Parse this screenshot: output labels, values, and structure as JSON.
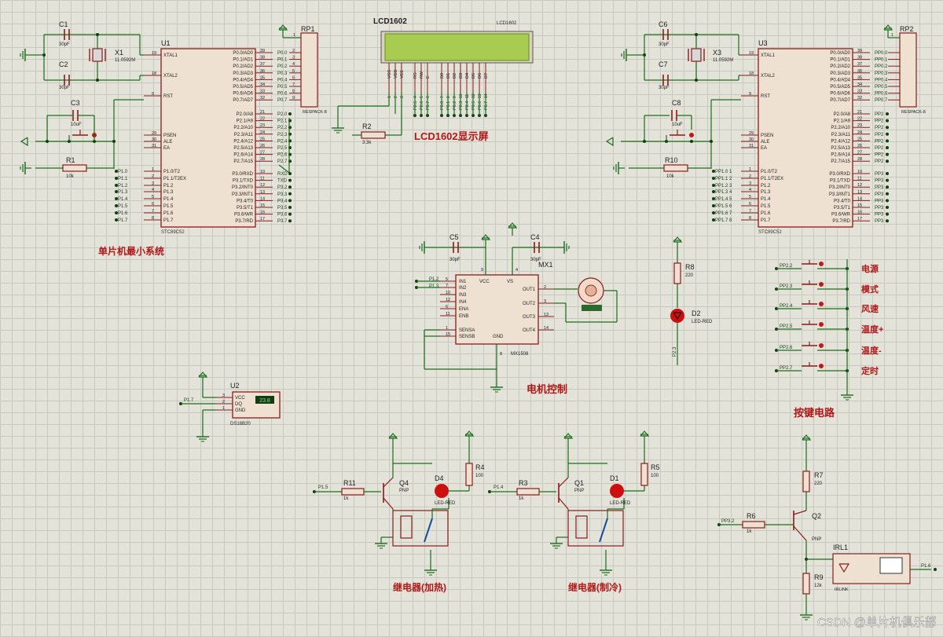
{
  "section_labels": {
    "mcu_min": "单片机最小系统",
    "lcd_screen": "LCD1602显示屏",
    "motor_ctrl": "电机控制",
    "keys": "按键电路",
    "relay_heat": "继电器(加热)",
    "relay_cool": "继电器(制冷)"
  },
  "key_labels": [
    "电源",
    "模式",
    "风速",
    "温度+",
    "温度-",
    "定时"
  ],
  "watermark": "CSDN @单片机俱乐部",
  "colors": {
    "background": "#e4e3da",
    "grid": "#c9c8be",
    "wire": "#1a6e1a",
    "component": "#8b1a1a",
    "chip_fill": "#efe1d2",
    "label_red": "#b01818",
    "lcd_screen": "#a8cc52",
    "pin_dot": "#123c12"
  },
  "u1": {
    "ref": "U1",
    "part": "STC89C52",
    "left_pins": [
      {
        "num": "19",
        "name": "XTAL1"
      },
      {
        "num": "18",
        "name": "XTAL2"
      },
      {
        "num": "9",
        "name": "RST"
      },
      {
        "num": "29",
        "name": "PSEN"
      },
      {
        "num": "30",
        "name": "ALE"
      },
      {
        "num": "31",
        "name": "EA"
      },
      {
        "num": "1",
        "name": "P1.0/T2"
      },
      {
        "num": "2",
        "name": "P1.1/T2EX"
      },
      {
        "num": "3",
        "name": "P1.2"
      },
      {
        "num": "4",
        "name": "P1.3"
      },
      {
        "num": "5",
        "name": "P1.4"
      },
      {
        "num": "6",
        "name": "P1.5"
      },
      {
        "num": "7",
        "name": "P1.6"
      },
      {
        "num": "8",
        "name": "P1.7"
      }
    ],
    "right_pins": [
      {
        "num": "39",
        "name": "P0.0/AD0"
      },
      {
        "num": "38",
        "name": "P0.1/AD1"
      },
      {
        "num": "37",
        "name": "P0.2/AD2"
      },
      {
        "num": "36",
        "name": "P0.3/AD3"
      },
      {
        "num": "35",
        "name": "P0.4/AD4"
      },
      {
        "num": "34",
        "name": "P0.5/AD5"
      },
      {
        "num": "33",
        "name": "P0.6/AD6"
      },
      {
        "num": "32",
        "name": "P0.7/AD7"
      },
      {
        "num": "21",
        "name": "P2.0/A8"
      },
      {
        "num": "22",
        "name": "P2.1/A9"
      },
      {
        "num": "23",
        "name": "P2.2/A10"
      },
      {
        "num": "24",
        "name": "P2.3/A11"
      },
      {
        "num": "25",
        "name": "P2.4/A12"
      },
      {
        "num": "26",
        "name": "P2.5/A13"
      },
      {
        "num": "27",
        "name": "P2.6/A14"
      },
      {
        "num": "28",
        "name": "P2.7/A15"
      },
      {
        "num": "10",
        "name": "P3.0/RXD"
      },
      {
        "num": "11",
        "name": "P3.1/TXD"
      },
      {
        "num": "12",
        "name": "P3.2/INT0"
      },
      {
        "num": "13",
        "name": "P3.3/INT1"
      },
      {
        "num": "14",
        "name": "P3.4/T0"
      },
      {
        "num": "15",
        "name": "P3.5/T1"
      },
      {
        "num": "16",
        "name": "P3.6/WR"
      },
      {
        "num": "17",
        "name": "P3.7/RD"
      }
    ],
    "left_net_labels": [
      "P1.0",
      "P1.1",
      "P1.2",
      "P1.3",
      "P1.4",
      "P1.5",
      "P1.6",
      "P1.7"
    ],
    "right_net_labels": [
      "P0.0",
      "P0.1",
      "P0.2",
      "P0.3",
      "P0.4",
      "P0.5",
      "P0.6",
      "P0.7",
      "P2.0",
      "P2.1",
      "P2.2",
      "P2.3",
      "P2.4",
      "P2.5",
      "P2.6",
      "P2.7",
      "RXD",
      "TXD",
      "P3.2",
      "P3.3",
      "P3.4",
      "P3.5",
      "P3.6",
      "P3.7"
    ]
  },
  "u3": {
    "ref": "U3",
    "part": "STC89C52",
    "left_net_labels": [
      "PP1.0 1",
      "PP1.1 2",
      "PP1.2 3",
      "PP1.3 4",
      "PP1.4 5",
      "PP1.5 6",
      "PP1.6 7",
      "PP1.7 8"
    ],
    "right_net_labels": [
      "PP0.0",
      "PP0.1",
      "PP0.2",
      "PP0.3",
      "PP0.4",
      "PP0.5",
      "PP0.6",
      "PP0.7",
      "PP2",
      "PP2",
      "PP2",
      "PP2",
      "PP2",
      "PP2",
      "PP2",
      "PP2",
      "PP3",
      "PP3",
      "PP3",
      "PP3",
      "PP3",
      "PP3",
      "PP3",
      "PP3"
    ]
  },
  "rp1": {
    "ref": "RP1",
    "part": "RESPACK-8",
    "pin1": "1"
  },
  "rp2": {
    "ref": "RP2",
    "part": "RESPACK-8",
    "pin1": "1"
  },
  "lcd": {
    "title": "LCD1602",
    "part": "LCD1602",
    "pins": [
      "VSS",
      "VDD",
      "VEE",
      "RS",
      "RW",
      "E",
      "D0",
      "D1",
      "D2",
      "D3",
      "D4",
      "D5",
      "D6",
      "D7"
    ],
    "pin_nums": [
      "1",
      "2",
      "3",
      "4",
      "5",
      "6",
      "7",
      "8",
      "9",
      "10",
      "11",
      "12",
      "13",
      "14"
    ],
    "nets": [
      "P2.5",
      "P2.6",
      "P2.7",
      "P0.0",
      "P0.1",
      "P0.2",
      "P0.3",
      "P0.4",
      "P0.5",
      "P0.6",
      "P0.7"
    ]
  },
  "left_mcu": {
    "c1": {
      "ref": "C1",
      "value": "30pF"
    },
    "c2": {
      "ref": "C2",
      "value": "30pF"
    },
    "x1": {
      "ref": "X1",
      "value": "11.0592M"
    },
    "c3": {
      "ref": "C3",
      "value": "10uF"
    },
    "r1": {
      "ref": "R1",
      "value": "10k"
    },
    "r2": {
      "ref": "R2",
      "value": "3.3k"
    }
  },
  "right_mcu": {
    "c6": {
      "ref": "C6",
      "value": "30pF"
    },
    "c7": {
      "ref": "C7",
      "value": "30pF"
    },
    "x3": {
      "ref": "X3",
      "value": "11.0592M"
    },
    "c8": {
      "ref": "C8",
      "value": "10uF"
    },
    "r10": {
      "ref": "R10",
      "value": "10k"
    }
  },
  "motor": {
    "c5": {
      "ref": "C5",
      "value": "30pF"
    },
    "c4": {
      "ref": "C4",
      "value": "30pF"
    },
    "ref": "MX1",
    "part": "MX1508",
    "pins_left": [
      {
        "num": "5",
        "name": "IN1"
      },
      {
        "num": "7",
        "name": "IN2"
      },
      {
        "num": "10",
        "name": "IN3"
      },
      {
        "num": "12",
        "name": "IN4"
      },
      {
        "num": "6",
        "name": "ENA"
      },
      {
        "num": "11",
        "name": "ENB"
      },
      {
        "num": "1",
        "name": "SENSA"
      },
      {
        "num": "15",
        "name": "SENSB"
      }
    ],
    "pins_right": [
      {
        "num": "2",
        "name": "OUT1"
      },
      {
        "num": "3",
        "name": "OUT2"
      },
      {
        "num": "13",
        "name": "OUT3"
      },
      {
        "num": "14",
        "name": "OUT4"
      }
    ],
    "pin_vcc": "VCC",
    "pin_vs": "VS",
    "pin_gnd": "GND",
    "num_vcc": "9",
    "num_vs": "4",
    "num_gnd": "8",
    "net_in1": "P1.2",
    "net_in2": "P1.3"
  },
  "led_d2": {
    "r_ref": "R8",
    "r_value": "220",
    "ref": "D2",
    "part": "LED-RED",
    "net": "P2.3"
  },
  "ds18b20": {
    "ref": "U2",
    "part": "DS18B20",
    "pins": [
      "VCC",
      "DQ",
      "GND"
    ],
    "nums": [
      "3",
      "2",
      "1"
    ],
    "display": "23.8",
    "net": "P1.7"
  },
  "keys_nets": [
    "PP2.2",
    "PP2.3",
    "PP2.4",
    "PP2.5",
    "PP2.6",
    "PP2.7"
  ],
  "relay_heat": {
    "r_base": {
      "ref": "R11",
      "value": "1k"
    },
    "q": {
      "ref": "Q4",
      "type": "PNP"
    },
    "d": {
      "ref": "D4",
      "part": "LED-RED"
    },
    "r_led": {
      "ref": "R4",
      "value": "100"
    },
    "net": "P1.5"
  },
  "relay_cool": {
    "r_base": {
      "ref": "R3",
      "value": "1k"
    },
    "q": {
      "ref": "Q1",
      "type": "PNP"
    },
    "d": {
      "ref": "D1",
      "part": "LED-RED"
    },
    "r_led": {
      "ref": "R5",
      "value": "100"
    },
    "net": "P1.4"
  },
  "ir": {
    "r7": {
      "ref": "R7",
      "value": "220"
    },
    "r6": {
      "ref": "R6",
      "value": "1k"
    },
    "q2": {
      "ref": "Q2",
      "type": "PNP"
    },
    "r9": {
      "ref": "R9",
      "value": "12k"
    },
    "irl": {
      "ref": "IRL1",
      "part": "IRLINK"
    },
    "net_in": "PP3.2",
    "net_out": "P1.6"
  }
}
